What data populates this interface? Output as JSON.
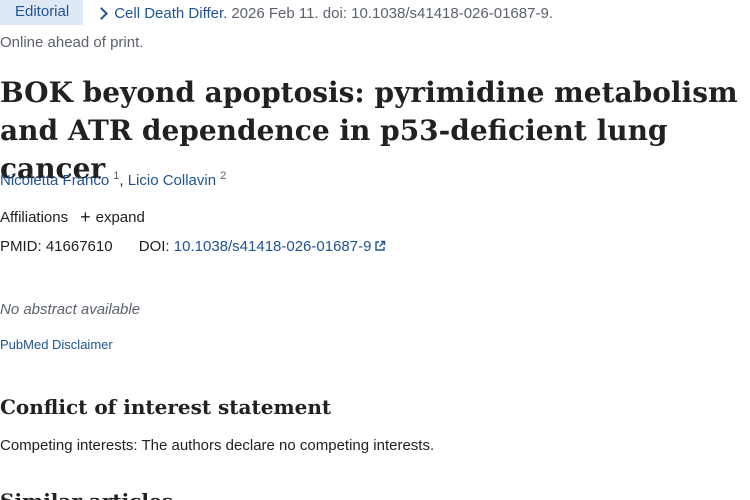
{
  "citation": {
    "article_type": "Editorial",
    "journal": "Cell Death Differ.",
    "details": "2026 Feb 11. doi: 10.1038/s41418-026-01687-9.",
    "status": "Online ahead of print."
  },
  "article": {
    "title": "BOK beyond apoptosis: pyrimidine metabolism and ATR dependence in p53-deficient lung cancer"
  },
  "authors": [
    {
      "name": "Nicoletta Franco",
      "affiliation": "1"
    },
    {
      "name": "Licio Collavin",
      "affiliation": "2"
    }
  ],
  "affiliations": {
    "label": "Affiliations",
    "expand_label": "expand"
  },
  "identifiers": {
    "pmid_label": "PMID:",
    "pmid": "41667610",
    "doi_label": "DOI:",
    "doi": "10.1038/s41418-026-01687-9"
  },
  "abstract": {
    "text": "No abstract available"
  },
  "disclaimer_link": "PubMed Disclaimer",
  "conflict": {
    "heading": "Conflict of interest statement",
    "text": "Competing interests: The authors declare no competing interests."
  },
  "next_section": {
    "heading": "Similar articles"
  },
  "colors": {
    "link": "#205493",
    "badge_bg": "#dfe9f6",
    "muted": "#5b616b",
    "text": "#212121"
  }
}
